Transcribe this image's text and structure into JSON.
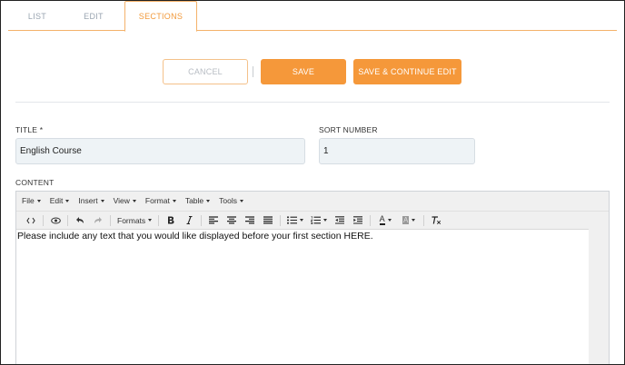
{
  "tabs": [
    {
      "label": "LIST",
      "active": false
    },
    {
      "label": "EDIT",
      "active": false
    },
    {
      "label": "SECTIONS",
      "active": true
    }
  ],
  "actions": {
    "cancel_label": "CANCEL",
    "save_label": "SAVE",
    "save_continue_label": "SAVE & CONTINUE EDIT"
  },
  "form": {
    "title_label": "TITLE *",
    "title_value": "English Course",
    "sort_label": "SORT NUMBER",
    "sort_value": "1",
    "content_label": "CONTENT"
  },
  "editor": {
    "menus": [
      "File",
      "Edit",
      "Insert",
      "View",
      "Format",
      "Table",
      "Tools"
    ],
    "formats_label": "Formats",
    "text_color_icon": "A",
    "bg_color_icon": "A",
    "content_text": "Please include any text that you would like displayed before your first section HERE."
  },
  "colors": {
    "accent": "#f5983a",
    "tab_active": "#f29a3c",
    "input_bg": "#eef3f6"
  }
}
